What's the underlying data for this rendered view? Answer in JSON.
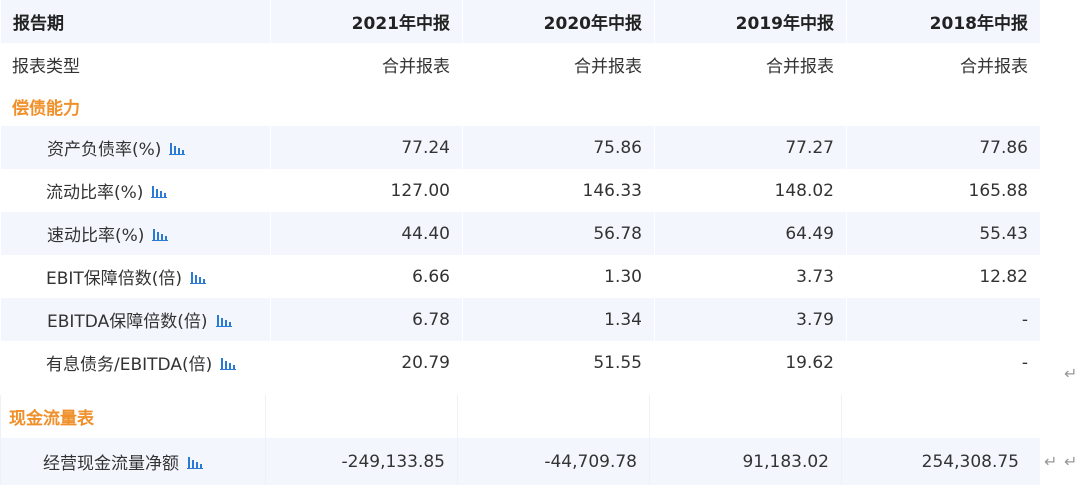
{
  "header": {
    "label": "报告期",
    "periods": [
      "2021年中报",
      "2020年中报",
      "2019年中报",
      "2018年中报"
    ]
  },
  "report_type": {
    "label": "报表类型",
    "values": [
      "合并报表",
      "合并报表",
      "合并报表",
      "合并报表"
    ]
  },
  "solvency": {
    "title": "偿债能力",
    "rows": [
      {
        "label": "资产负债率(%)",
        "values": [
          "77.24",
          "75.86",
          "77.27",
          "77.86"
        ]
      },
      {
        "label": "流动比率(%)",
        "values": [
          "127.00",
          "146.33",
          "148.02",
          "165.88"
        ]
      },
      {
        "label": "速动比率(%)",
        "values": [
          "44.40",
          "56.78",
          "64.49",
          "55.43"
        ]
      },
      {
        "label": "EBIT保障倍数(倍)",
        "values": [
          "6.66",
          "1.30",
          "3.73",
          "12.82"
        ]
      },
      {
        "label": "EBITDA保障倍数(倍)",
        "values": [
          "6.78",
          "1.34",
          "3.79",
          "-"
        ]
      },
      {
        "label": "有息债务/EBITDA(倍)",
        "values": [
          "20.79",
          "51.55",
          "19.62",
          "-"
        ]
      }
    ]
  },
  "cashflow": {
    "title": "现金流量表",
    "rows": [
      {
        "label": "经营现金流量净额",
        "values": [
          "-249,133.85",
          "-44,709.78",
          "91,183.02",
          "254,308.75"
        ]
      }
    ]
  },
  "return_symbol": "↵",
  "icons": {
    "chart": "bar-chart-icon"
  },
  "colors": {
    "section": "#f0902a",
    "icon": "#2b7bd6",
    "band": "#f3f7fd"
  }
}
